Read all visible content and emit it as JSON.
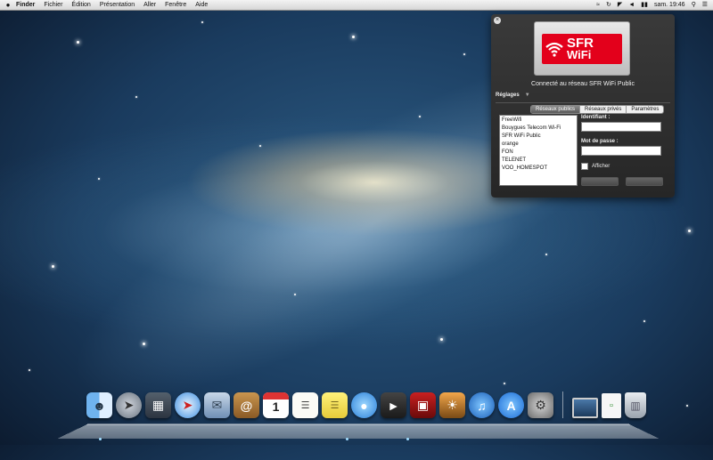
{
  "menubar": {
    "app": "Finder",
    "menus": [
      "Fichier",
      "Édition",
      "Présentation",
      "Aller",
      "Fenêtre",
      "Aide"
    ],
    "clock": "sam. 19:46"
  },
  "panel": {
    "logo": {
      "line1": "SFR",
      "line2": "WiFi"
    },
    "status": "Connecté au réseau SFR WiFi Public",
    "settings_label": "Réglages",
    "tabs": [
      "Réseaux publics",
      "Réseaux privés",
      "Paramètres"
    ],
    "active_tab": "Réseaux publics",
    "networks": [
      "FreeWifi",
      "Bouygues Telecom Wi-Fi",
      "SFR WiFi Public",
      "orange",
      "FON",
      "TELENET",
      "VOO_HOMESPOT"
    ],
    "identifiant_label": "Identifiant :",
    "password_label": "Mot de passe :",
    "show_label": "Afficher"
  },
  "dock": {
    "calendar_day": "1",
    "apps": [
      "finder-icon",
      "launchpad-icon",
      "mission-control-icon",
      "safari-icon",
      "mail-icon",
      "contacts-icon",
      "calendar-icon",
      "reminders-icon",
      "notes-icon",
      "messages-icon",
      "facetime-icon",
      "photo-booth-icon",
      "iphoto-icon",
      "itunes-icon",
      "app-store-icon",
      "system-preferences-icon",
      "sfr-wifi-icon",
      "document-icon",
      "trash-icon"
    ]
  }
}
